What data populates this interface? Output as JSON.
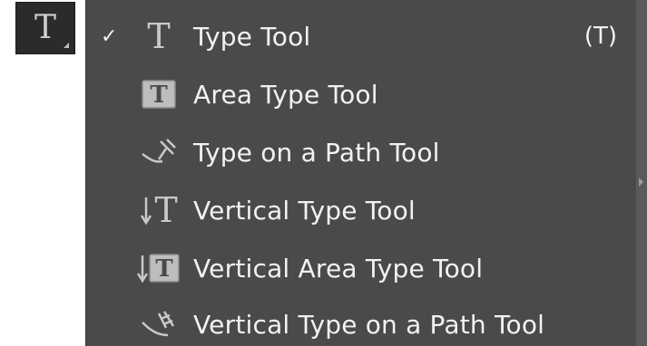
{
  "tool_button": {
    "glyph": "T",
    "icon": "type-tool-icon"
  },
  "menu": {
    "items": [
      {
        "label": "Type Tool",
        "shortcut": "(T)",
        "checked": true,
        "check_glyph": "✓",
        "icon": "type-icon",
        "icon_glyph": "T"
      },
      {
        "label": "Area Type Tool",
        "shortcut": "",
        "checked": false,
        "icon": "area-type-icon",
        "icon_glyph": "T"
      },
      {
        "label": "Type on a Path Tool",
        "shortcut": "",
        "checked": false,
        "icon": "type-on-path-icon"
      },
      {
        "label": "Vertical Type Tool",
        "shortcut": "",
        "checked": false,
        "icon": "vertical-type-icon",
        "icon_glyph": "T"
      },
      {
        "label": "Vertical Area Type Tool",
        "shortcut": "",
        "checked": false,
        "icon": "vertical-area-type-icon",
        "icon_glyph": "T"
      },
      {
        "label": "Vertical Type on a Path Tool",
        "shortcut": "",
        "checked": false,
        "icon": "vertical-type-on-path-icon"
      }
    ]
  },
  "colors": {
    "menu_bg": "#4a4a4a",
    "tool_button_bg": "#2b2b2b",
    "text": "#f2f2f2",
    "icon": "#c9c9c9"
  }
}
